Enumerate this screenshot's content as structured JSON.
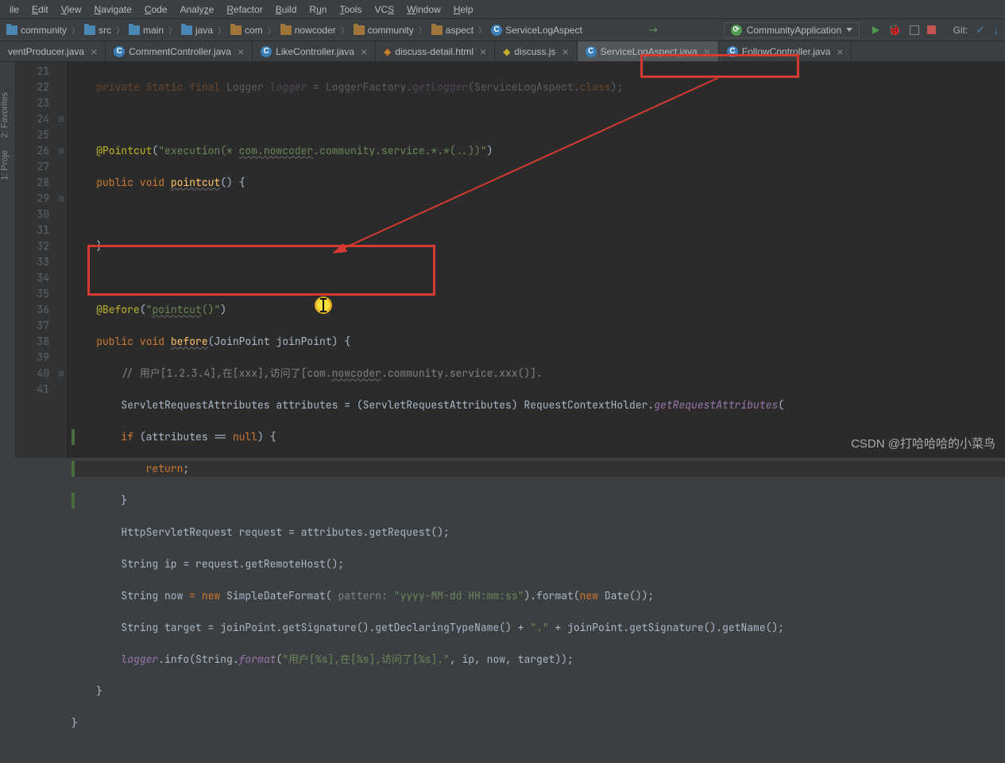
{
  "menu": {
    "items": [
      "ile",
      "Edit",
      "View",
      "Navigate",
      "Code",
      "Analyze",
      "Refactor",
      "Build",
      "Run",
      "Tools",
      "VCS",
      "Window",
      "Help"
    ]
  },
  "breadcrumbs": [
    "community",
    "src",
    "main",
    "java",
    "com",
    "nowcoder",
    "community",
    "aspect",
    "ServiceLogAspect"
  ],
  "run_config": "CommunityApplication",
  "git_label": "Git:",
  "tabs": [
    {
      "label": "ventProducer.java",
      "type": "java",
      "active": false
    },
    {
      "label": "CommentController.java",
      "type": "java",
      "active": false
    },
    {
      "label": "LikeController.java",
      "type": "java",
      "active": false
    },
    {
      "label": "discuss-detail.html",
      "type": "html",
      "active": false
    },
    {
      "label": "discuss.js",
      "type": "js",
      "active": false
    },
    {
      "label": "ServiceLogAspect.java",
      "type": "java",
      "active": true
    },
    {
      "label": "FollowController.java",
      "type": "java",
      "active": false
    }
  ],
  "sidebar_labels": {
    "project": "1: Proje",
    "favorites": "2: Favorites"
  },
  "lines": {
    "start": 21,
    "end": 41,
    "l21": "private Static final Logger logger = LoggerFactory.getLogger(ServiceLogAspect.class);",
    "l23a": "@Pointcut",
    "l23b": "(\"execution(* com.nowcoder.community.service.*.*(..))\")",
    "l24a": "public void ",
    "l24b": "pointcut",
    "l24c": "() {",
    "l26": "}",
    "l28a": "@Before",
    "l28b": "(\"pointcut()\")",
    "l29a": "public void ",
    "l29b": "before",
    "l29c": "(JoinPoint joinPoint) {",
    "l30": "// 用户[1.2.3.4],在[xxx],访问了[com.nowcoder.community.service.xxx()].",
    "l31a": "ServletRequestAttributes attributes ",
    "l31b": "=",
    "l31c": " (ServletRequestAttributes) RequestContextHolder.",
    "l31d": "getRequestAttributes",
    "l31e": "(",
    "l32a": "if ",
    "l32b": "(attributes == ",
    "l32c": "null",
    "l32d": ") {",
    "l33": "return;",
    "l34": "}",
    "l35a": "HttpServletRequest request ",
    "l35b": "=",
    "l35c": " attributes.getRequest();",
    "l36a": "String ip ",
    "l36b": "=",
    "l36c": " request.getRemoteHost();",
    "l37a": "String now ",
    "l37b": "= new ",
    "l37c": "SimpleDateFormat( ",
    "l37p": "pattern: ",
    "l37d": "\"yyyy-MM-dd HH:mm:ss\"",
    "l37e": ").format(",
    "l37f": "new ",
    "l37g": "Date());",
    "l38a": "String target ",
    "l38b": "=",
    "l38c": " joinPoint.getSignature().getDeclaringTypeName() + ",
    "l38d": "\".\"",
    "l38e": " + joinPoint.getSignature().getName();",
    "l39a": "logger",
    "l39b": ".info(String.",
    "l39c": "format",
    "l39d": "(",
    "l39e": "\"用户[%s],在[%s],访问了[%s].\"",
    "l39f": ", ip, now, target));",
    "l40": "}",
    "l41": "}"
  },
  "watermark": "CSDN @打哈哈哈的小菜鸟"
}
